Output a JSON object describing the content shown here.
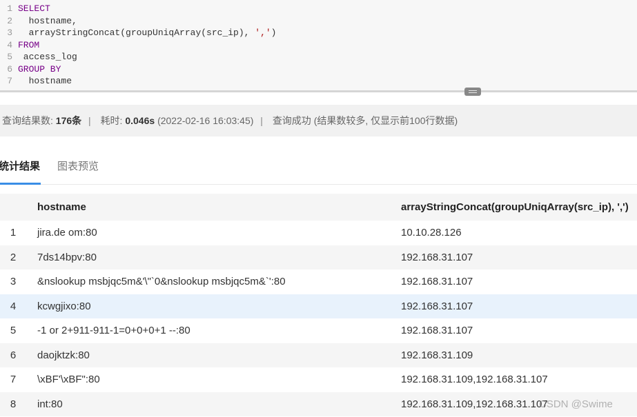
{
  "editor": {
    "lines": [
      {
        "num": "1",
        "segments": [
          {
            "t": "SELECT",
            "c": "kw"
          }
        ]
      },
      {
        "num": "2",
        "segments": [
          {
            "t": "  hostname,",
            "c": "code"
          }
        ]
      },
      {
        "num": "3",
        "segments": [
          {
            "t": "  arrayStringConcat(groupUniqArray(src_ip), ",
            "c": "code"
          },
          {
            "t": "','",
            "c": "str"
          },
          {
            "t": ")",
            "c": "code"
          }
        ]
      },
      {
        "num": "4",
        "segments": [
          {
            "t": "FROM",
            "c": "kw"
          }
        ]
      },
      {
        "num": "5",
        "segments": [
          {
            "t": " access_log",
            "c": "code"
          }
        ]
      },
      {
        "num": "6",
        "segments": [
          {
            "t": "GROUP BY",
            "c": "kw"
          }
        ]
      },
      {
        "num": "7",
        "segments": [
          {
            "t": "  hostname",
            "c": "code"
          }
        ]
      }
    ]
  },
  "status": {
    "count_label": "查询结果数:",
    "count_value": "176条",
    "time_label": "耗时:",
    "time_value": "0.046s",
    "timestamp": "(2022-02-16 16:03:45)",
    "message": "查询成功 (结果数较多, 仅显示前100行数据)"
  },
  "tabs": [
    {
      "label": "统计结果",
      "active": true
    },
    {
      "label": "图表预览",
      "active": false
    }
  ],
  "table": {
    "columns": [
      "hostname",
      "arrayStringConcat(groupUniqArray(src_ip), ',')"
    ],
    "rows": [
      {
        "idx": "1",
        "hostname": "jira.de        om:80",
        "ip": "10.10.28.126"
      },
      {
        "idx": "2",
        "hostname": "7ds14bpv:80",
        "ip": "192.168.31.107"
      },
      {
        "idx": "3",
        "hostname": "&nslookup msbjqc5m&'\\\"`0&nslookup msbjqc5m&`':80",
        "ip": "192.168.31.107"
      },
      {
        "idx": "4",
        "hostname": "kcwgjixo:80",
        "ip": "192.168.31.107"
      },
      {
        "idx": "5",
        "hostname": "-1 or 2+911-911-1=0+0+0+1 --:80",
        "ip": "192.168.31.107"
      },
      {
        "idx": "6",
        "hostname": "daojktzk:80",
        "ip": "192.168.31.109"
      },
      {
        "idx": "7",
        "hostname": "\\xBF'\\xBF\":80",
        "ip": "192.168.31.109,192.168.31.107"
      },
      {
        "idx": "8",
        "hostname": "int:80",
        "ip": "192.168.31.109,192.168.31.107"
      }
    ],
    "highlighted_row": "4"
  },
  "watermark": "CSDN @Swime"
}
